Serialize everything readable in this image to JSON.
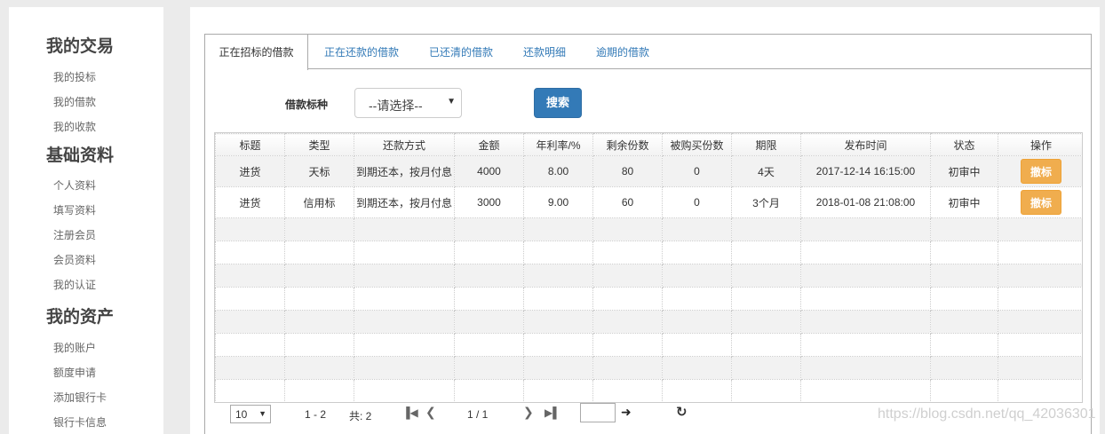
{
  "sidebar": {
    "sections": [
      {
        "title": "我的交易",
        "items": [
          "我的投标",
          "我的借款",
          "我的收款"
        ]
      },
      {
        "title": "基础资料",
        "items": [
          "个人资料",
          "填写资料",
          "注册会员",
          "会员资料",
          "我的认证"
        ]
      },
      {
        "title": "我的资产",
        "items": [
          "我的账户",
          "额度申请",
          "添加银行卡",
          "银行卡信息"
        ]
      }
    ]
  },
  "tabs": [
    "正在招标的借款",
    "正在还款的借款",
    "已还清的借款",
    "还款明细",
    "逾期的借款"
  ],
  "search": {
    "label": "借款标种",
    "select_value": "--请选择--",
    "button": "搜索"
  },
  "table": {
    "headers": [
      "标题",
      "类型",
      "还款方式",
      "金额",
      "年利率/%",
      "剩余份数",
      "被购买份数",
      "期限",
      "发布时间",
      "状态",
      "操作"
    ],
    "rows": [
      [
        "进货",
        "天标",
        "到期还本，按月付息",
        "4000",
        "8.00",
        "80",
        "0",
        "4天",
        "2017-12-14 16:15:00",
        "初审中",
        "撤标"
      ],
      [
        "进货",
        "信用标",
        "到期还本，按月付息",
        "3000",
        "9.00",
        "60",
        "0",
        "3个月",
        "2018-01-08 21:08:00",
        "初审中",
        "撤标"
      ]
    ]
  },
  "pager": {
    "page_size": "10",
    "range": "1 - 2",
    "total": "共: 2",
    "page": "1 / 1"
  },
  "watermark": "https://blog.csdn.net/qq_42036301",
  "colors": {
    "primary": "#337ab7",
    "warning": "#f0ad4e"
  }
}
